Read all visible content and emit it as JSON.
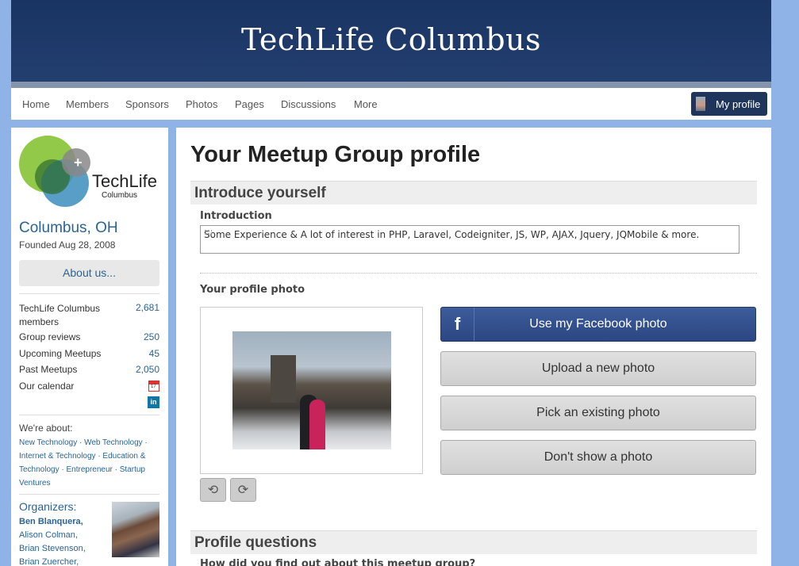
{
  "banner": {
    "title": "TechLife Columbus"
  },
  "nav": {
    "items": [
      "Home",
      "Members",
      "Sponsors",
      "Photos",
      "Pages",
      "Discussions",
      "More"
    ],
    "profile_label": "My profile"
  },
  "sidebar": {
    "logo_text": "TechLife",
    "logo_sub": "Columbus",
    "city": "Columbus, OH",
    "founded": "Founded Aug 28, 2008",
    "about_label": "About us...",
    "stats": [
      {
        "label": "TechLife Columbus members",
        "value": "2,681"
      },
      {
        "label": "Group reviews",
        "value": "250"
      },
      {
        "label": "Upcoming Meetups",
        "value": "45"
      },
      {
        "label": "Past Meetups",
        "value": "2,050"
      },
      {
        "label": "Our calendar",
        "value": ""
      }
    ],
    "calendar_day": "17",
    "linkedin_label": "in",
    "about_heading": "We're about:",
    "topics": "New Technology · Web Technology · Internet & Technology · Education & Technology · Entrepreneur · Startup Ventures",
    "organizers_heading": "Organizers:",
    "organizers": [
      "Ben Blanquera,",
      "Alison Colman,",
      "Brian Stevenson,",
      "Brian Zuercher,"
    ]
  },
  "main": {
    "page_title": "Your Meetup Group profile",
    "intro_section": "Introduce yourself",
    "intro_label": "Introduction",
    "intro_value": "Some Experience & A lot of interest in PHP, Laravel, Codeigniter, JS, WP, AJAX, Jquery, JQMobile & more.",
    "photo_label": "Your profile photo",
    "buttons": {
      "facebook": "Use my Facebook photo",
      "facebook_icon": "f",
      "upload": "Upload a new photo",
      "pick": "Pick an existing photo",
      "none": "Don't show a photo"
    },
    "questions_section": "Profile questions",
    "question_1": "How did you find out about this meetup group?"
  }
}
